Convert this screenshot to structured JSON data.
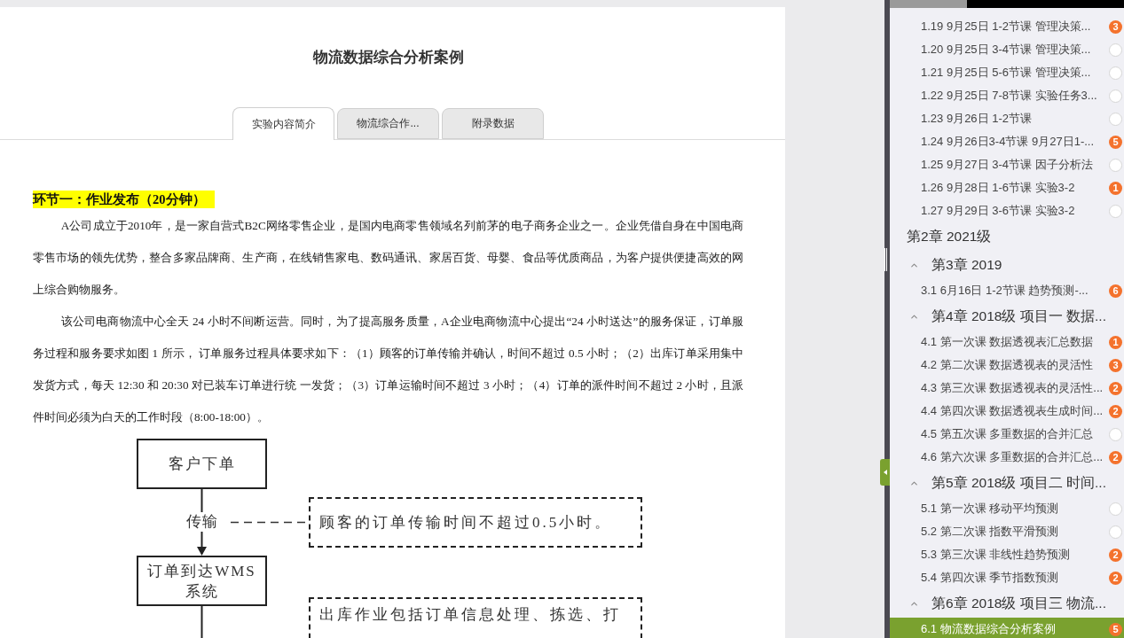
{
  "page": {
    "title": "物流数据综合分析案例"
  },
  "tabs": [
    {
      "label": "实验内容简介",
      "selected": true
    },
    {
      "label": "物流综合作...",
      "selected": false
    },
    {
      "label": "附录数据",
      "selected": false
    }
  ],
  "content": {
    "heading": "环节一：作业发布（20分钟）",
    "paragraphs": [
      "A公司成立于2010年，是一家自营式B2C网络零售企业，是国内电商零售领域名列前茅的电子商务企业之一。企业凭借自身在中国电商零售市场的领先优势，整合多家品牌商、生产商，在线销售家电、数码通讯、家居百货、母婴、食品等优质商品，为客户提供便捷高效的网上综合购物服务。",
      "该公司电商物流中心全天 24 小时不间断运营。同时，为了提高服务质量，A企业电商物流中心提出“24 小时送达”的服务保证，订单服务过程和服务要求如图 1 所示， 订单服务过程具体要求如下：（1）顾客的订单传输并确认，时间不超过 0.5 小时；（2）出库订单采用集中发货方式，每天 12:30 和 20:30 对已装车订单进行统 一发货；（3）订单运输时间不超过 3 小时；（4）订单的派件时间不超过 2 小时，且派件时间必须为白天的工作时段（8:00-18:00）。"
    ],
    "flowchart": {
      "nodes": [
        {
          "label": "客户下单"
        },
        {
          "label": "订单到达WMS系统"
        }
      ],
      "edge_label": "传输",
      "notes": [
        "顾客的订单传输时间不超过0.5小时。",
        "出库作业包括订单信息处理、拣选、打"
      ]
    }
  },
  "sidebar": {
    "lessons": [
      {
        "label": "1.19 9月25日 1-2节课 管理决策...",
        "count": "3",
        "selected": false
      },
      {
        "label": "1.20 9月25日 3-4节课 管理决策...",
        "selected": false
      },
      {
        "label": "1.21 9月25日 5-6节课 管理决策...",
        "selected": false
      },
      {
        "label": "1.22 9月25日 7-8节课 实验任务3...",
        "selected": false
      },
      {
        "label": "1.23 9月26日 1-2节课",
        "selected": false
      },
      {
        "label": "1.24 9月26日3-4节课 9月27日1-...",
        "count": "5",
        "selected": false
      },
      {
        "label": "1.25 9月27日 3-4节课 因子分析法",
        "selected": false
      },
      {
        "label": "1.26 9月28日 1-6节课 实验3-2",
        "count": "1",
        "selected": false
      },
      {
        "label": "1.27 9月29日 3-6节课 实验3-2",
        "selected": false
      }
    ],
    "chapters": [
      {
        "title": "第2章 2021级"
      },
      {
        "title": "第3章 2019",
        "expanded": true,
        "children": [
          {
            "label": "3.1 6月16日 1-2节课 趋势预测-...",
            "count": "6",
            "selected": false
          }
        ]
      },
      {
        "title": "第4章 2018级 项目一 数据...",
        "expanded": true,
        "children": [
          {
            "label": "4.1 第一次课 数据透视表汇总数据",
            "count": "1",
            "selected": false
          },
          {
            "label": "4.2 第二次课 数据透视表的灵活性",
            "count": "3",
            "selected": false
          },
          {
            "label": "4.3 第三次课 数据透视表的灵活性...",
            "count": "2",
            "selected": false
          },
          {
            "label": "4.4 第四次课 数据透视表生成时间...",
            "count": "2",
            "selected": false
          },
          {
            "label": "4.5 第五次课 多重数据的合并汇总",
            "selected": false
          },
          {
            "label": "4.6 第六次课 多重数据的合并汇总...",
            "count": "2",
            "selected": false
          }
        ]
      },
      {
        "title": "第5章 2018级 项目二 时间...",
        "expanded": true,
        "children": [
          {
            "label": "5.1 第一次课 移动平均预测",
            "selected": false
          },
          {
            "label": "5.2 第二次课 指数平滑预测",
            "selected": false
          },
          {
            "label": "5.3 第三次课 非线性趋势预测",
            "count": "2",
            "selected": false
          },
          {
            "label": "5.4 第四次课 季节指数预测",
            "count": "2",
            "selected": false
          }
        ]
      },
      {
        "title": "第6章 2018级 项目三 物流...",
        "expanded": true,
        "children": [
          {
            "label": "6.1 物流数据综合分析案例",
            "count": "5",
            "selected": true
          }
        ]
      }
    ]
  }
}
